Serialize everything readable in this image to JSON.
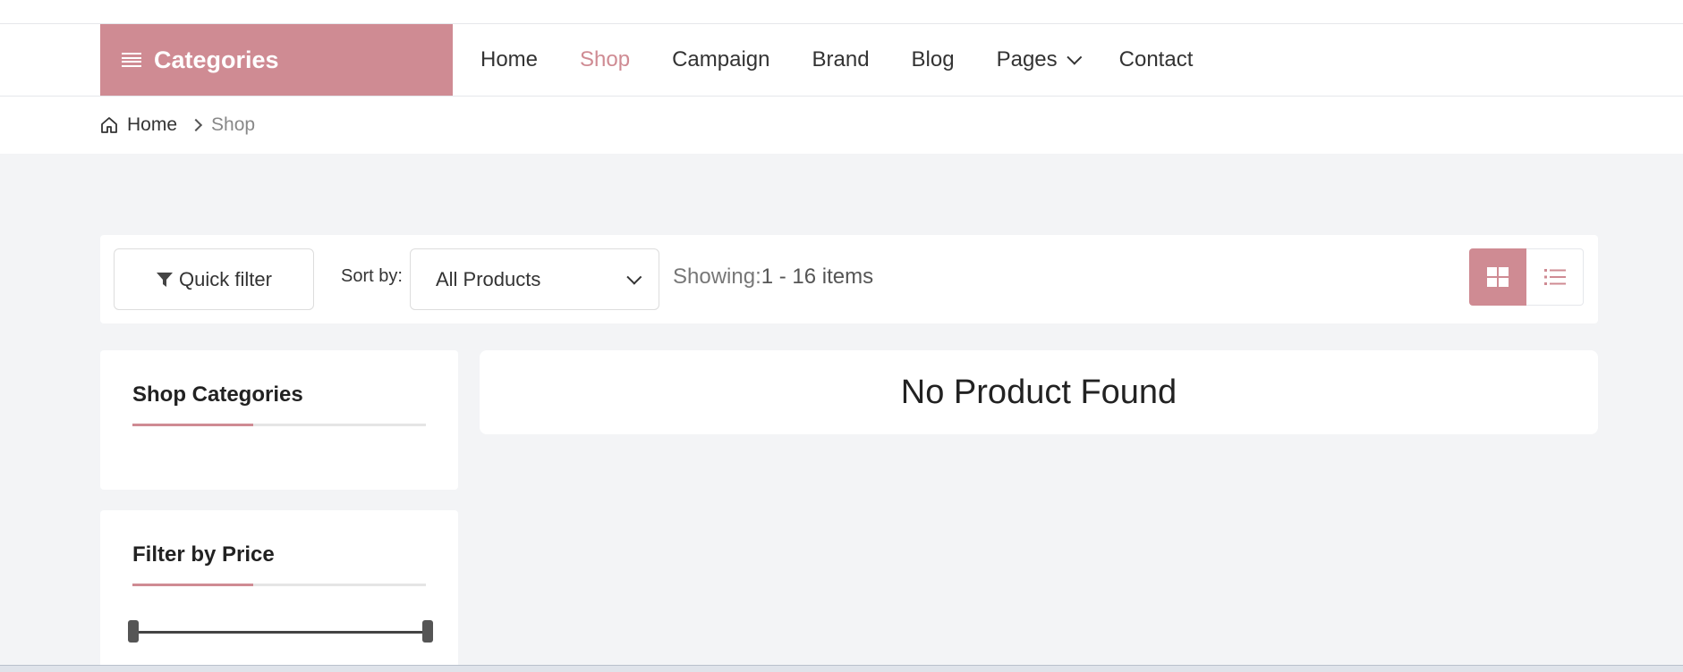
{
  "header": {
    "categories_label": "Categories",
    "nav": [
      {
        "label": "Home",
        "active": false
      },
      {
        "label": "Shop",
        "active": true
      },
      {
        "label": "Campaign",
        "active": false
      },
      {
        "label": "Brand",
        "active": false
      },
      {
        "label": "Blog",
        "active": false
      },
      {
        "label": "Pages",
        "active": false,
        "has_dropdown": true
      },
      {
        "label": "Contact",
        "active": false
      }
    ]
  },
  "breadcrumb": {
    "home": "Home",
    "current": "Shop"
  },
  "toolbar": {
    "quick_filter": "Quick filter",
    "sort_label": "Sort by:",
    "sort_value": "All Products",
    "showing_label": "Showing:",
    "showing_value": "1 - 16 items"
  },
  "sidebar": {
    "categories_title": "Shop Categories",
    "price_title": "Filter by Price"
  },
  "main": {
    "empty_message": "No Product Found"
  },
  "colors": {
    "accent": "#cf8b93",
    "background": "#f3f4f6"
  }
}
